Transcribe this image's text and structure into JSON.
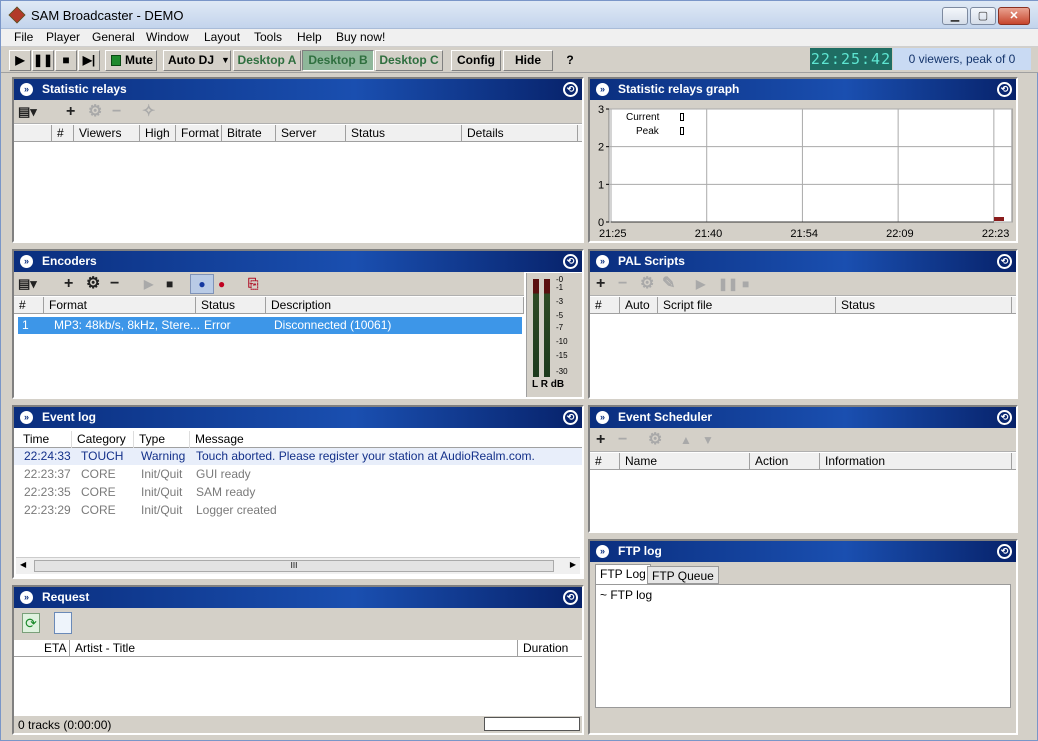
{
  "window": {
    "title": "SAM Broadcaster - DEMO"
  },
  "menu": [
    "File",
    "Player",
    "General",
    "Window",
    "Layout",
    "Tools",
    "Help",
    "Buy now!"
  ],
  "toolbar": {
    "mute": "Mute",
    "autodj": "Auto DJ",
    "desktops": [
      "Desktop A",
      "Desktop B",
      "Desktop C"
    ],
    "config": "Config",
    "hide": "Hide",
    "help": "?",
    "clock": "22:25:42",
    "viewers": "0 viewers, peak of 0"
  },
  "relays": {
    "title": "Statistic relays",
    "columns": [
      "#",
      "Viewers",
      "High",
      "Format",
      "Bitrate",
      "Server",
      "Status",
      "Details"
    ]
  },
  "graph": {
    "title": "Statistic relays graph",
    "legend": [
      "Current",
      "Peak"
    ],
    "y_ticks": [
      "3",
      "2",
      "1",
      "0"
    ],
    "x_ticks": [
      "21:25",
      "21:40",
      "21:54",
      "22:09",
      "22:23"
    ]
  },
  "chart_data": {
    "type": "line",
    "title": "Statistic relays graph",
    "x": [
      "21:25",
      "21:40",
      "21:54",
      "22:09",
      "22:23"
    ],
    "ylim": [
      0,
      3
    ],
    "series": [
      {
        "name": "Current",
        "values": [
          0,
          0,
          0,
          0,
          0
        ]
      },
      {
        "name": "Peak",
        "values": [
          0,
          0,
          0,
          0,
          0
        ]
      }
    ],
    "legend": "top-left",
    "grid": true
  },
  "encoders": {
    "title": "Encoders",
    "columns": [
      "#",
      "Format",
      "Status",
      "Description"
    ],
    "rows": [
      {
        "num": "1",
        "format": "MP3: 48kb/s, 8kHz, Stere...",
        "status": "Error",
        "description": "Disconnected (10061)"
      }
    ],
    "vu_scale": [
      "-0",
      "-1",
      "-3",
      "-5",
      "-7",
      "-10",
      "-15",
      "-30"
    ],
    "vu_labels": "L R dB"
  },
  "pal": {
    "title": "PAL Scripts",
    "columns": [
      "#",
      "Auto",
      "Script file",
      "Status"
    ]
  },
  "eventlog": {
    "title": "Event log",
    "columns": [
      "Time",
      "Category",
      "Type",
      "Message"
    ],
    "rows": [
      {
        "time": "22:24:33",
        "category": "TOUCH",
        "type": "Warning",
        "message": "Touch aborted. Please register your station at AudioRealm.com."
      },
      {
        "time": "22:23:37",
        "category": "CORE",
        "type": "Init/Quit",
        "message": "GUI ready"
      },
      {
        "time": "22:23:35",
        "category": "CORE",
        "type": "Init/Quit",
        "message": "SAM ready"
      },
      {
        "time": "22:23:29",
        "category": "CORE",
        "type": "Init/Quit",
        "message": "Logger created"
      }
    ],
    "scroll_mid": "III"
  },
  "scheduler": {
    "title": "Event Scheduler",
    "columns": [
      "#",
      "Name",
      "Action",
      "Information"
    ]
  },
  "request": {
    "title": "Request",
    "columns": [
      "ETA",
      "Artist - Title",
      "Duration"
    ],
    "status": "0 tracks (0:00:00)"
  },
  "ftp": {
    "title": "FTP log",
    "tabs": [
      "FTP Log",
      "FTP Queue"
    ],
    "content": "~ FTP log"
  }
}
